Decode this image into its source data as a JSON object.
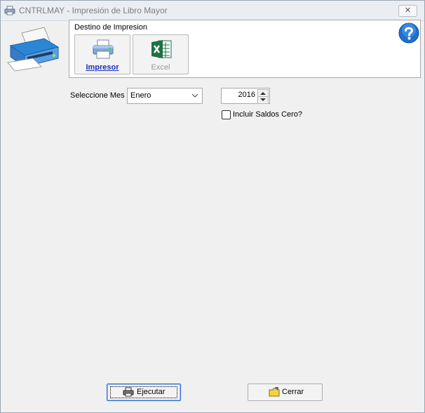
{
  "window": {
    "title": "CNTRLMAY - Impresión de Libro Mayor",
    "close_label": "✕"
  },
  "destination": {
    "group_label": "Destino de Impresion",
    "printer_label": "Impresor",
    "excel_label": "Excel"
  },
  "form": {
    "month_label": "Seleccione Mes",
    "month_value": "Enero",
    "year_value": "2016",
    "zero_balances_label": "Incluir Saldos Cero?",
    "zero_balances_checked": false
  },
  "actions": {
    "execute_label": "Ejecutar",
    "close_label": "Cerrar"
  },
  "colors": {
    "link_blue": "#1a2ec0",
    "help_blue": "#1f6fd1",
    "excel_green": "#1e7145"
  }
}
